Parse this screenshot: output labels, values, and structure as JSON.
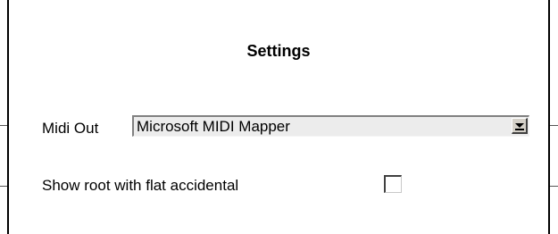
{
  "dialog": {
    "title": "Settings"
  },
  "midi_out": {
    "label": "Midi Out",
    "selected": "Microsoft MIDI Mapper"
  },
  "show_root_flat": {
    "label": "Show root with flat accidental",
    "checked": false
  }
}
